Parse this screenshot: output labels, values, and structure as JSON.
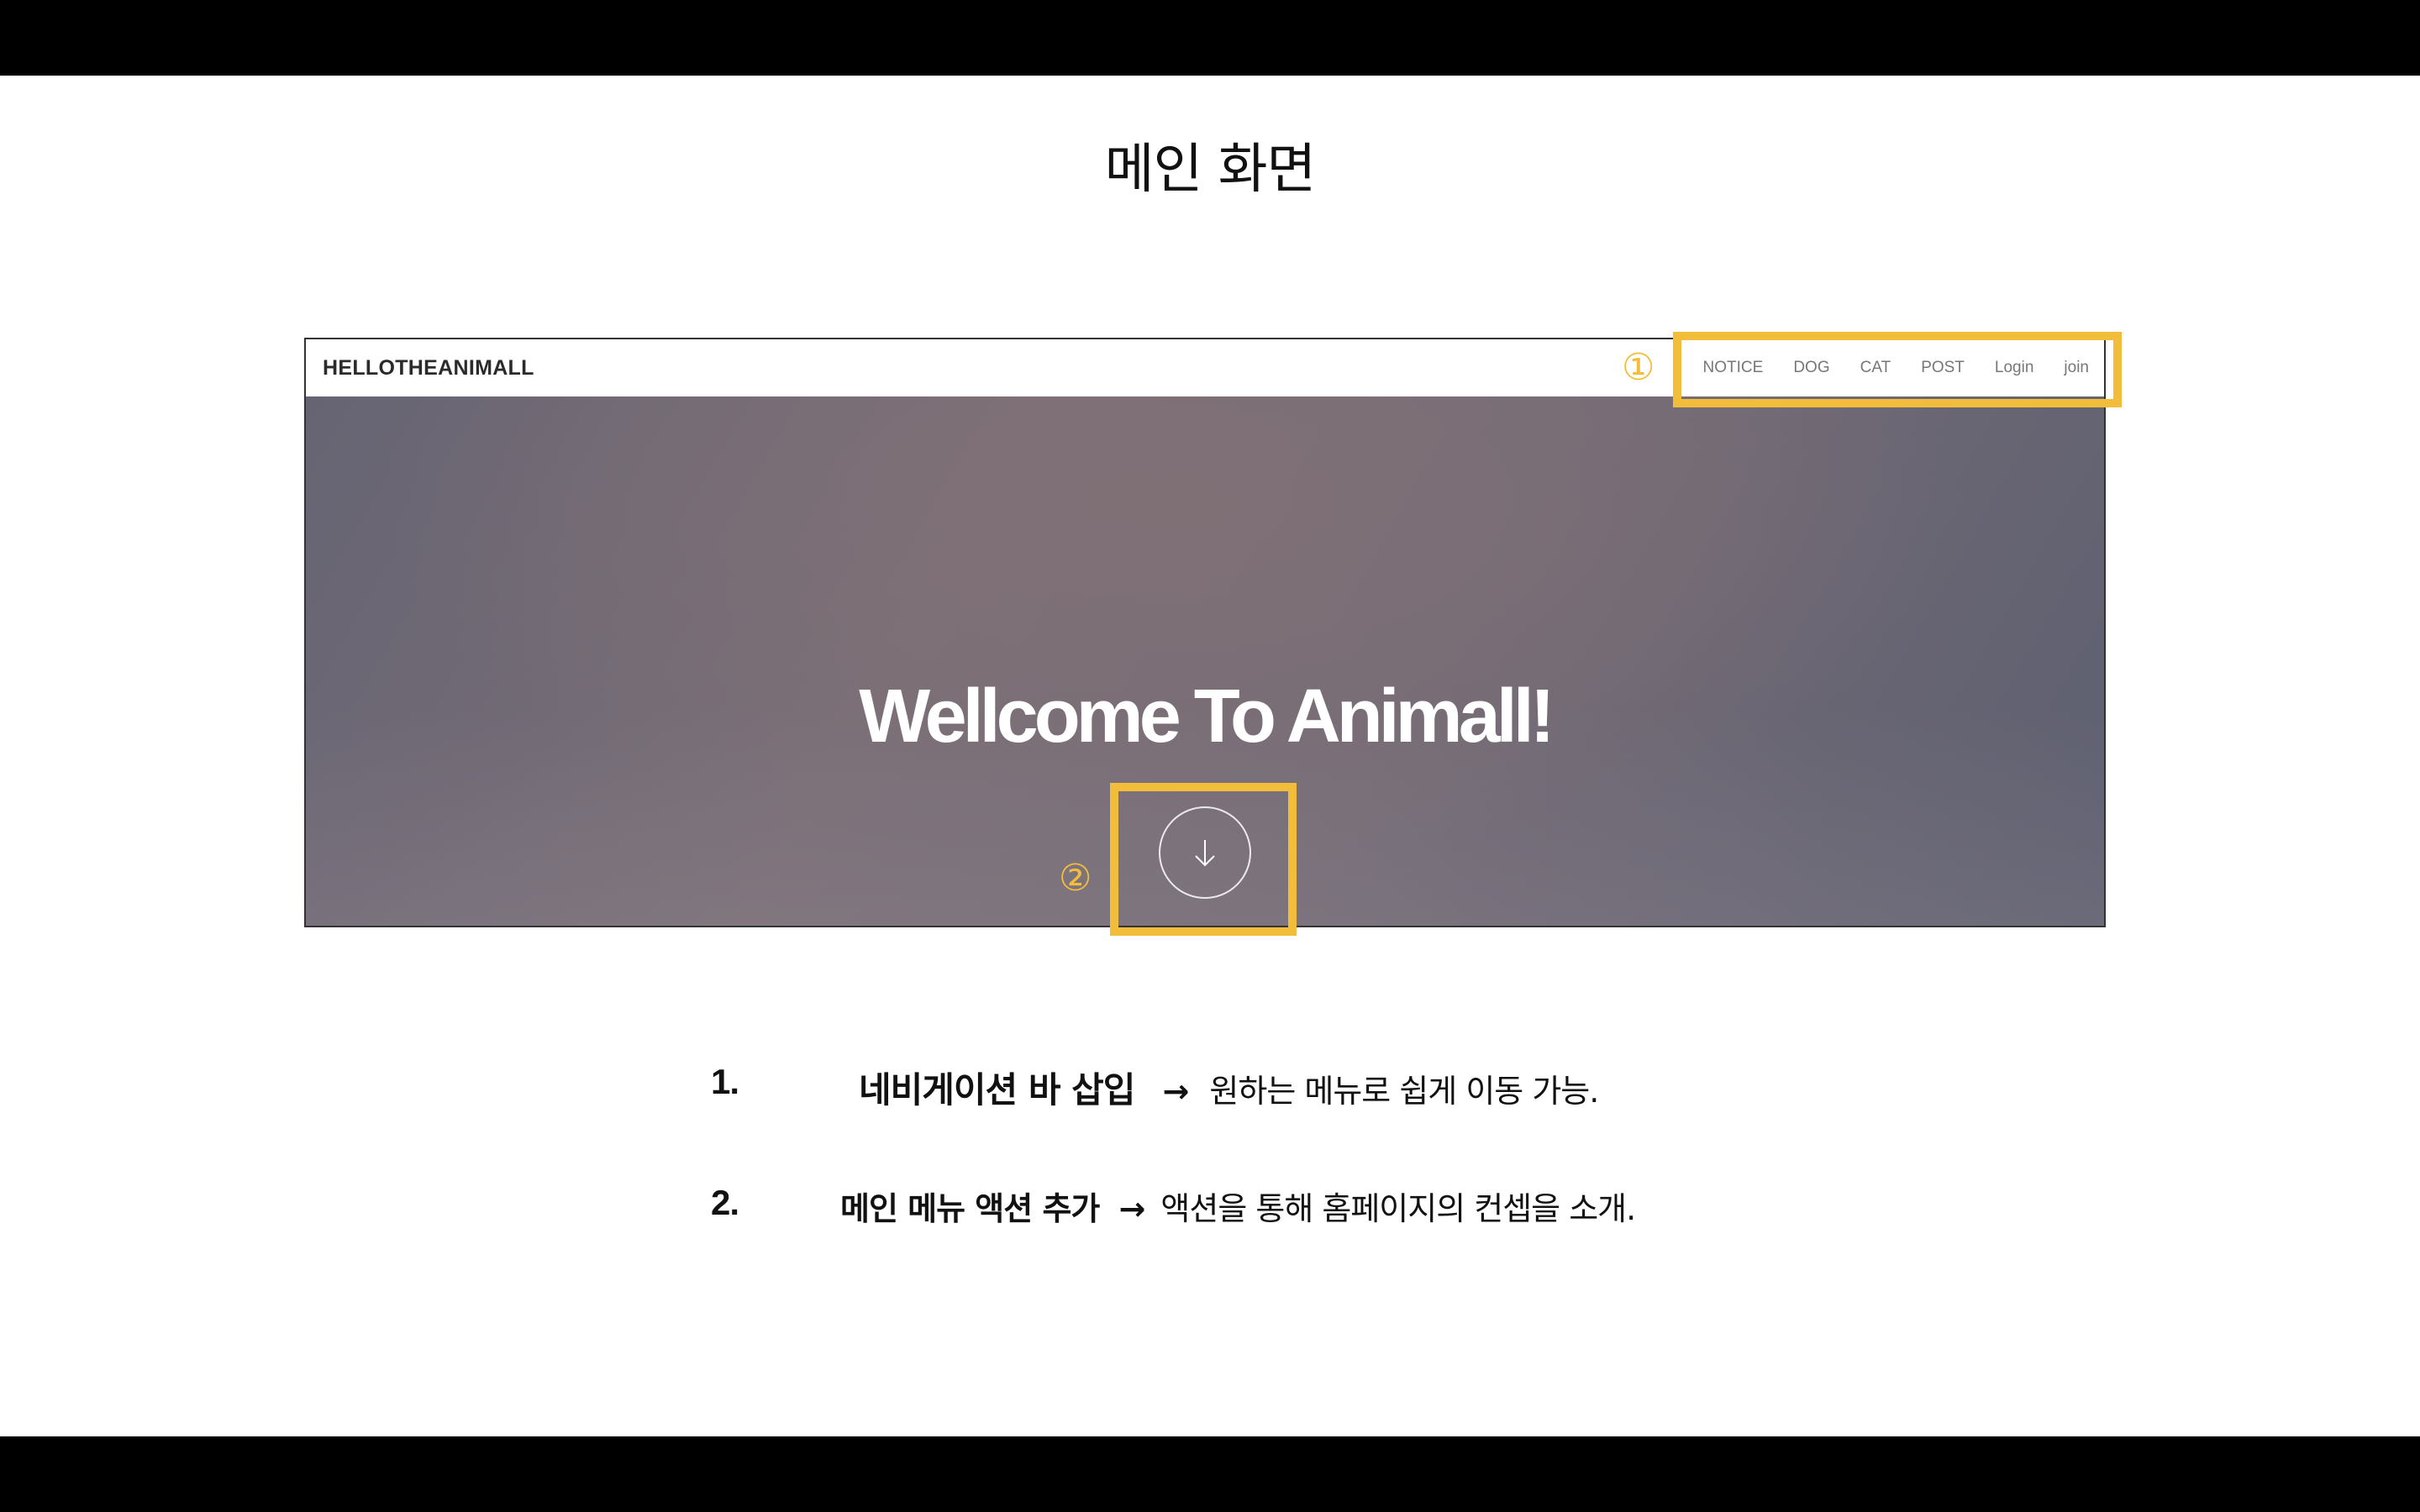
{
  "slide": {
    "title": "메인 화면"
  },
  "site": {
    "brand": "HELLOTHEANIMALL",
    "nav": [
      "NOTICE",
      "DOG",
      "CAT",
      "POST",
      "Login",
      "join"
    ],
    "hero_title": "Wellcome To Animall!",
    "scroll_icon": "arrow-down-circle-icon"
  },
  "annotations": {
    "marker_1": "①",
    "marker_2": "②",
    "highlight_color": "#f3bd3c"
  },
  "descriptions": [
    {
      "number": "1.",
      "feature": "네비게이션 바 삽입",
      "arrow": "→",
      "detail": "원하는 메뉴로 쉽게 이동 가능."
    },
    {
      "number": "2.",
      "feature": "메인 메뉴 액션 추가",
      "arrow": "→",
      "detail": "액션을 통해 홈페이지의 컨셉을 소개."
    }
  ]
}
